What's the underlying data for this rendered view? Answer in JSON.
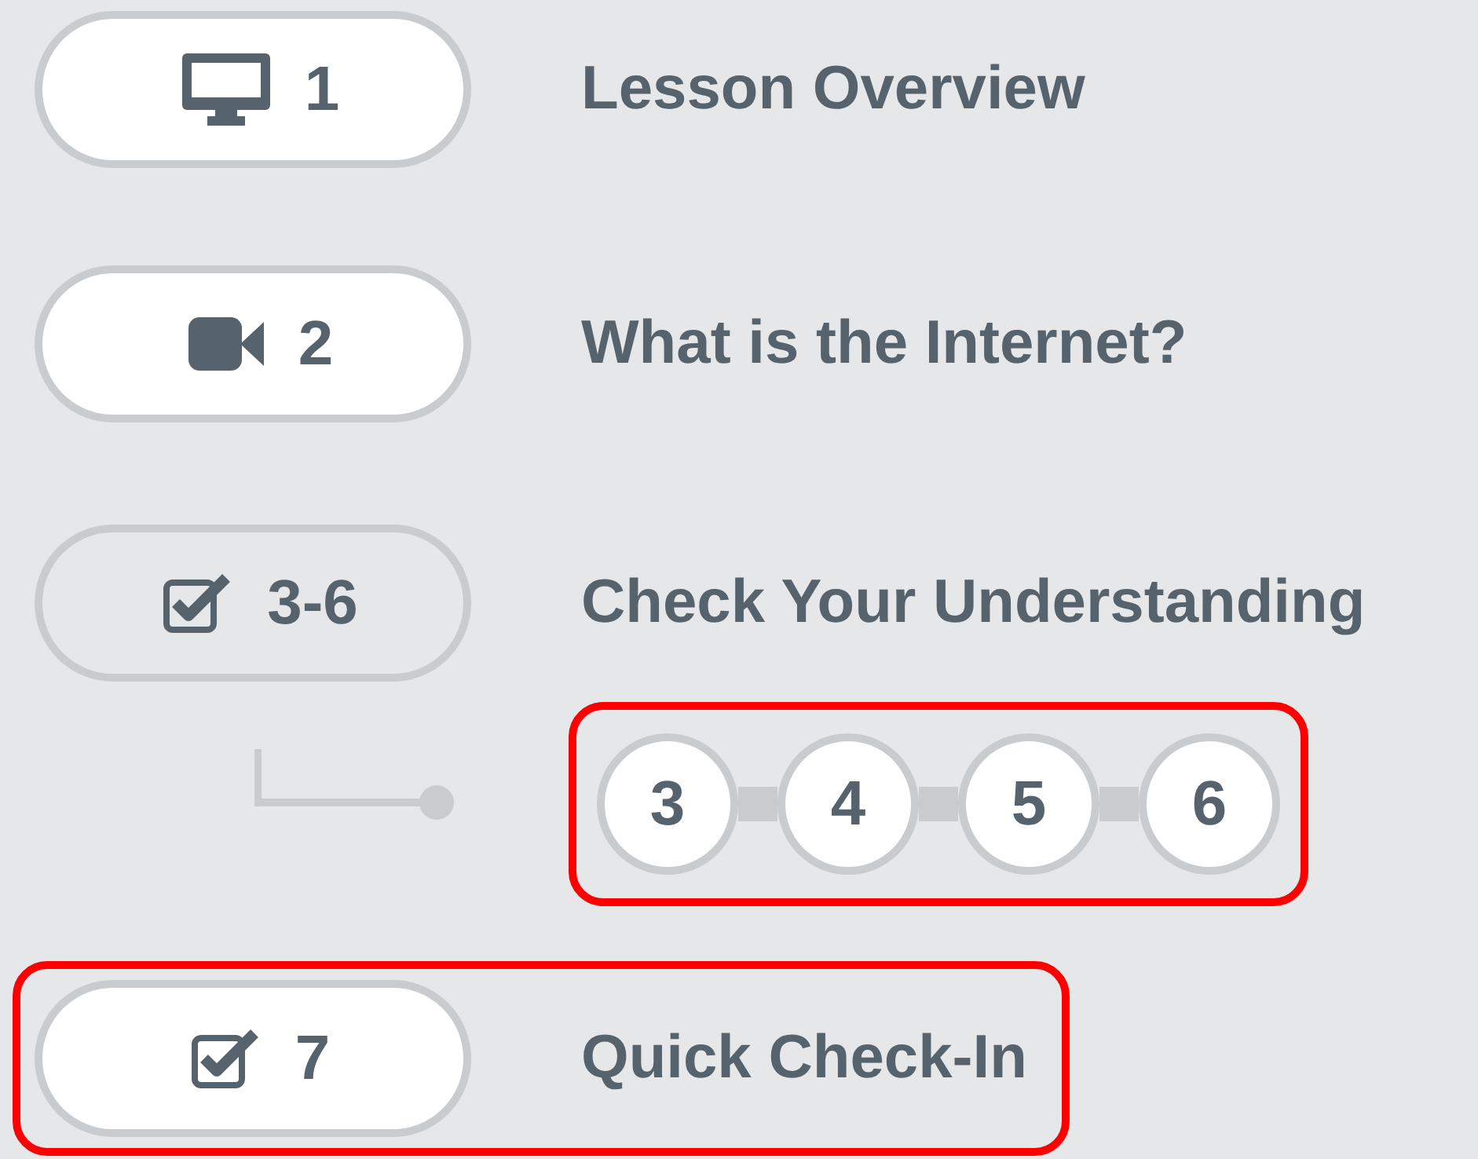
{
  "lessons": [
    {
      "kind": "monitor",
      "number": "1",
      "title": "Lesson Overview",
      "expanded": false,
      "highlighted": false
    },
    {
      "kind": "video",
      "number": "2",
      "title": "What is the Internet?",
      "expanded": false,
      "highlighted": false
    },
    {
      "kind": "checkbox",
      "number": "3-6",
      "title": "Check Your Understanding",
      "expanded": true,
      "highlighted": false,
      "steps": {
        "highlighted": true,
        "items": [
          "3",
          "4",
          "5",
          "6"
        ]
      }
    },
    {
      "kind": "checkbox",
      "number": "7",
      "title": "Quick Check-In",
      "expanded": false,
      "highlighted": true
    }
  ]
}
